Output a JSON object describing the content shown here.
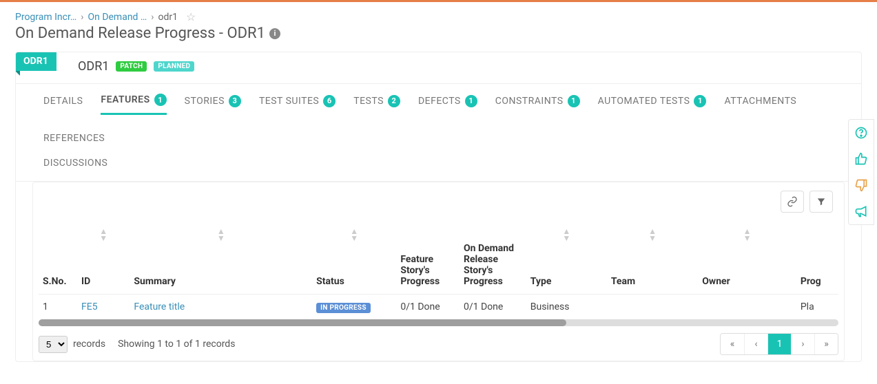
{
  "breadcrumb": {
    "items": [
      "Program Incr…",
      "On Demand …",
      "odr1"
    ]
  },
  "page_title": "On Demand Release Progress - ODR1",
  "header": {
    "chip": "ODR1",
    "name": "ODR1",
    "badge_patch": "PATCH",
    "badge_status": "PLANNED"
  },
  "tabs": [
    {
      "label": "DETAILS"
    },
    {
      "label": "FEATURES",
      "count": 1,
      "active": true
    },
    {
      "label": "STORIES",
      "count": 3
    },
    {
      "label": "TEST SUITES",
      "count": 6
    },
    {
      "label": "TESTS",
      "count": 2
    },
    {
      "label": "DEFECTS",
      "count": 1
    },
    {
      "label": "CONSTRAINTS",
      "count": 1
    },
    {
      "label": "AUTOMATED TESTS",
      "count": 1
    },
    {
      "label": "ATTACHMENTS"
    },
    {
      "label": "REFERENCES"
    }
  ],
  "tabs_row2": [
    {
      "label": "DISCUSSIONS"
    }
  ],
  "table": {
    "columns": [
      "S.No.",
      "ID",
      "Summary",
      "Status",
      "Feature Story's Progress",
      "On Demand Release Story's Progress",
      "Type",
      "Team",
      "Owner",
      "Prog"
    ],
    "rows": [
      {
        "sno": "1",
        "id": "FE5",
        "summary": "Feature title",
        "status": "IN PROGRESS",
        "feature_progress": "0/1 Done",
        "odr_progress": "0/1 Done",
        "type": "Business",
        "team": "",
        "owner": "",
        "prog": "Pla"
      }
    ]
  },
  "footer": {
    "records_value": "5",
    "records_label": "records",
    "showing": "Showing 1 to 1 of 1 records",
    "page": "1"
  },
  "icons": {
    "star": "star-icon",
    "info": "info-icon",
    "link": "link-icon",
    "filter": "filter-icon",
    "help": "help-icon",
    "thumbs_up": "thumbs-up-icon",
    "pin": "pin-icon",
    "megaphone": "megaphone-icon",
    "first": "«",
    "prev": "‹",
    "next": "›",
    "last": "»"
  },
  "colors": {
    "teal": "#19c3b4",
    "link": "#3a8fb7"
  }
}
